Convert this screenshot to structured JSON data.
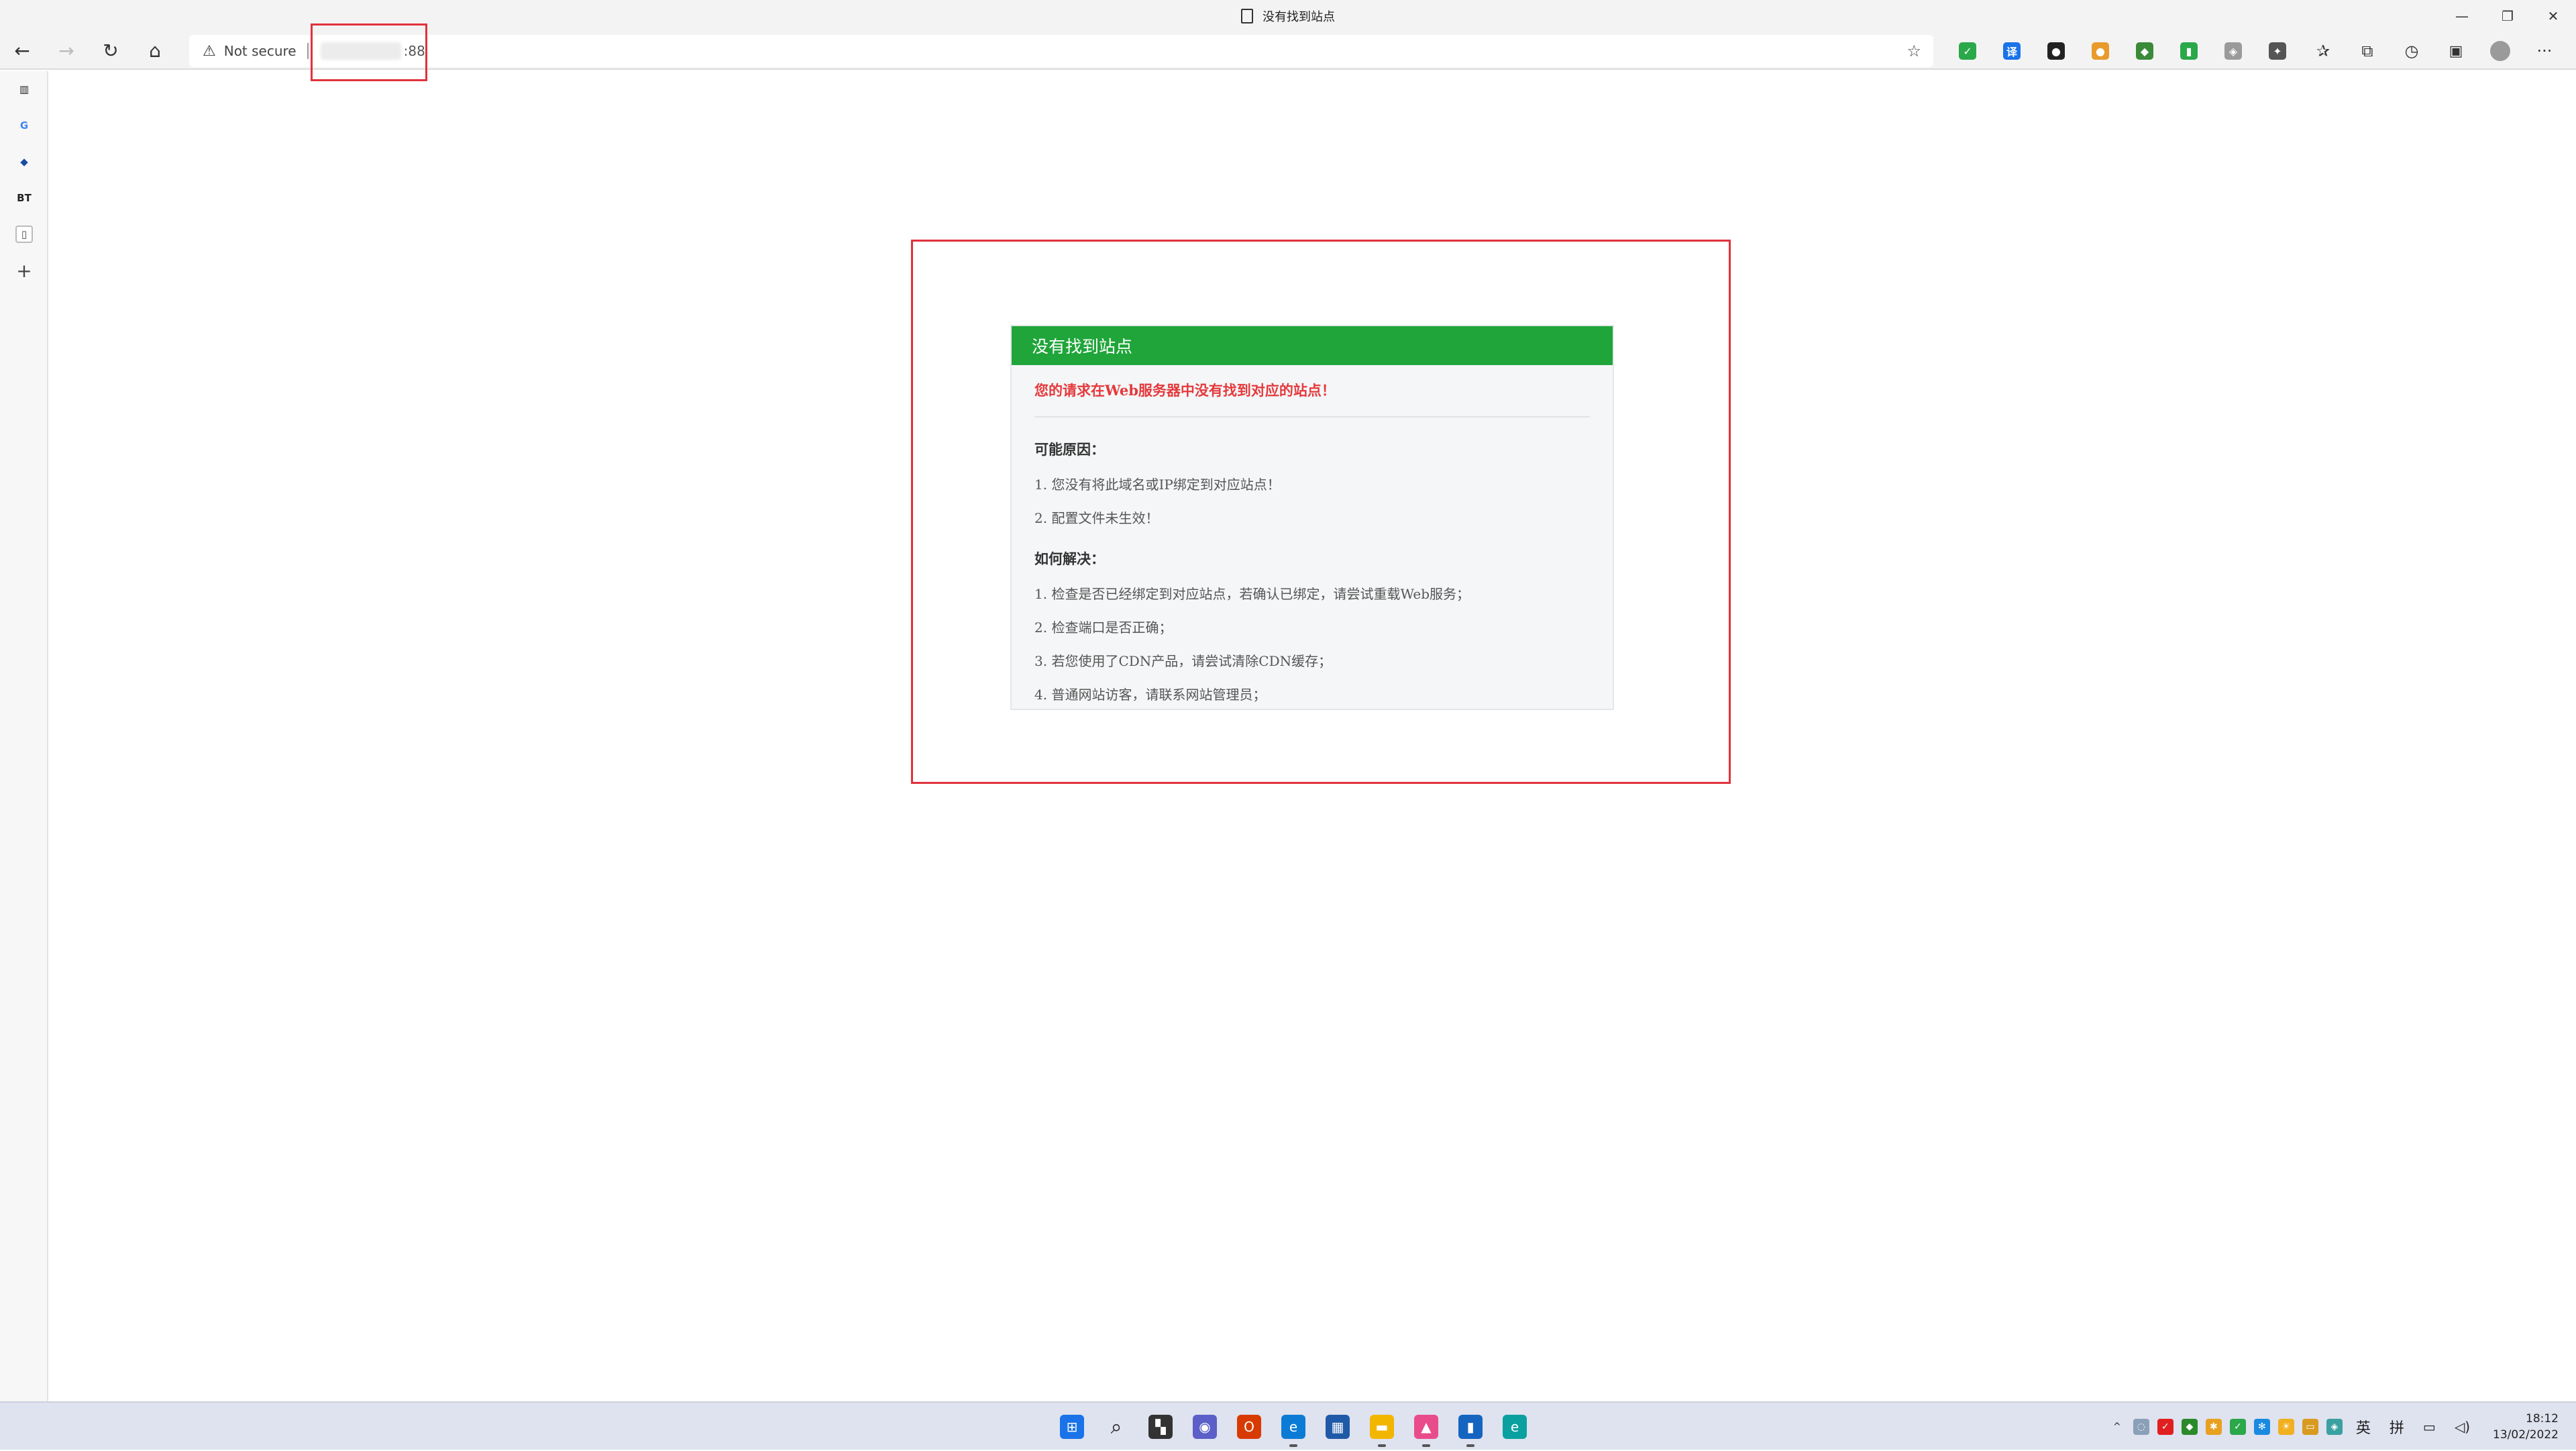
{
  "window": {
    "title": "没有找到站点",
    "controls": [
      "minimize",
      "restore",
      "close"
    ]
  },
  "toolbar": {
    "security_label": "Not secure",
    "url_port": ":88",
    "extensions": [
      {
        "name": "shield-extension-icon",
        "color": "#2aa84a",
        "glyph": "✓"
      },
      {
        "name": "translate-extension-icon",
        "color": "#1a73e8",
        "glyph": "译"
      },
      {
        "name": "mask-extension-icon",
        "color": "#222222",
        "glyph": "●"
      },
      {
        "name": "cookie-extension-icon",
        "color": "#e89b2c",
        "glyph": "●"
      },
      {
        "name": "sync-extension-icon",
        "color": "#3a8a3a",
        "glyph": "◆"
      },
      {
        "name": "notes-extension-icon",
        "color": "#2aa84a",
        "glyph": "▮"
      },
      {
        "name": "privacy-extension-icon",
        "color": "#9a9a9a",
        "glyph": "◈"
      },
      {
        "name": "puzzle-extension-icon",
        "color": "#555555",
        "glyph": "✦"
      }
    ]
  },
  "sidebar": {
    "tabs": [
      {
        "name": "sidebar-tab-reader",
        "glyph": "▥",
        "color": "#222"
      },
      {
        "name": "sidebar-tab-google",
        "glyph": "G",
        "color": "#4285f4"
      },
      {
        "name": "sidebar-tab-scholar",
        "glyph": "◆",
        "color": "#1a4ca0"
      },
      {
        "name": "sidebar-tab-bt",
        "glyph": "BT",
        "color": "#222"
      },
      {
        "name": "sidebar-tab-current",
        "glyph": "▯",
        "color": "#444"
      }
    ]
  },
  "page": {
    "header": "没有找到站点",
    "error": "您的请求在Web服务器中没有找到对应的站点！",
    "reasons_title": "可能原因：",
    "reasons": [
      "1.  您没有将此域名或IP绑定到对应站点！",
      "2.  配置文件未生效！"
    ],
    "solutions_title": "如何解决：",
    "solutions": [
      "1.  检查是否已经绑定到对应站点，若确认已绑定，请尝试重载Web服务；",
      "2.  检查端口是否正确；",
      "3.  若您使用了CDN产品，请尝试清除CDN缓存；",
      "4.  普通网站访客，请联系网站管理员；"
    ],
    "colors": {
      "header_bg": "#20a53a",
      "error_text": "#e4393c"
    }
  },
  "taskbar": {
    "apps": [
      {
        "name": "start-icon",
        "color": "#1a73e8",
        "glyph": "⊞",
        "running": false
      },
      {
        "name": "search-icon",
        "color": "#dfe2ef",
        "glyph": "⌕",
        "running": false
      },
      {
        "name": "task-view-icon",
        "color": "#333333",
        "glyph": "▚",
        "running": false
      },
      {
        "name": "chat-icon",
        "color": "#5b5fc7",
        "glyph": "◉",
        "running": false
      },
      {
        "name": "office-icon",
        "color": "#d83b01",
        "glyph": "O",
        "running": false
      },
      {
        "name": "edge-icon",
        "color": "#0c7bd6",
        "glyph": "e",
        "running": true
      },
      {
        "name": "store-icon",
        "color": "#1f5aa8",
        "glyph": "▦",
        "running": false
      },
      {
        "name": "file-explorer-icon",
        "color": "#f2b600",
        "glyph": "▬",
        "running": true
      },
      {
        "name": "paint-icon",
        "color": "#e94c8b",
        "glyph": "▲",
        "running": true
      },
      {
        "name": "notes-app-icon",
        "color": "#1565c0",
        "glyph": "▮",
        "running": true
      },
      {
        "name": "edge-dev-icon",
        "color": "#0aa0a0",
        "glyph": "e",
        "running": false
      }
    ],
    "tray": [
      {
        "name": "tray-chevron-icon",
        "color": "#dfe2ef",
        "glyph": "^"
      },
      {
        "name": "tray-drop-icon",
        "color": "#8aa0b8",
        "glyph": "◌"
      },
      {
        "name": "tray-antivirus-icon",
        "color": "#e02020",
        "glyph": "✓"
      },
      {
        "name": "tray-sync-icon",
        "color": "#2a8a2a",
        "glyph": "◆"
      },
      {
        "name": "tray-apps-icon",
        "color": "#e8a020",
        "glyph": "✱"
      },
      {
        "name": "tray-check-icon",
        "color": "#2aa84a",
        "glyph": "✓"
      },
      {
        "name": "tray-bluetooth-icon",
        "color": "#1a8ae0",
        "glyph": "✻"
      },
      {
        "name": "tray-sun-icon",
        "color": "#f0b020",
        "glyph": "☀"
      },
      {
        "name": "tray-folder-icon",
        "color": "#d89a20",
        "glyph": "▭"
      },
      {
        "name": "tray-shield-icon",
        "color": "#3aa0a0",
        "glyph": "◈"
      }
    ],
    "ime_lang": "英",
    "ime_mode": "拼",
    "time": "18:12",
    "date": "13/02/2022"
  }
}
